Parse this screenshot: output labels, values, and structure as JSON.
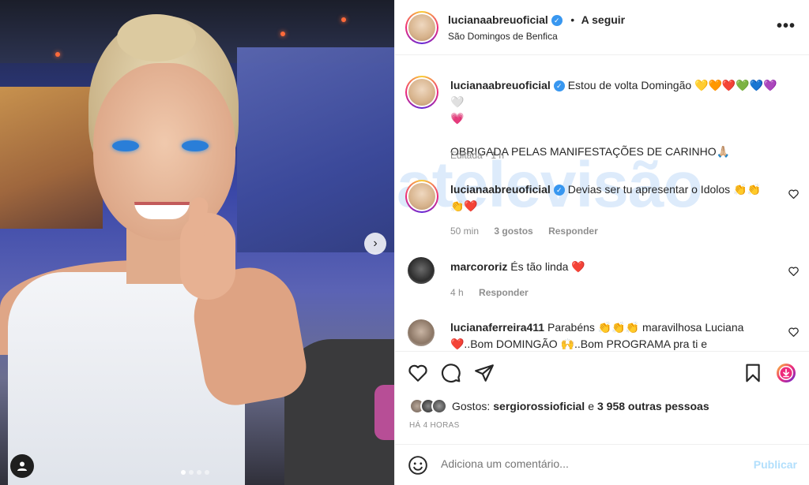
{
  "post": {
    "author": "lucianaabreuoficial",
    "follow_label": "A seguir",
    "location": "São Domingos de Benfica",
    "more_label": "•••"
  },
  "caption": {
    "author": "lucianaabreuoficial",
    "line1": "Estou de volta Domingão 💛🧡❤️💚💙💜🤍",
    "line2": "💗",
    "line3": "OBRIGADA PELAS MANIFESTAÇÕES DE CARINHO🙏🏼",
    "edited": "Editada · 1 h"
  },
  "comments": [
    {
      "author": "lucianaabreuoficial",
      "text_line1": "Devias ser tu apresentar o Idolos 👏👏",
      "text_line2": "👏❤️",
      "time": "50 min",
      "likes": "3 gostos",
      "reply": "Responder"
    },
    {
      "author": "marcororiz",
      "text_line1": "És tão linda ❤️",
      "time": "4 h",
      "reply": "Responder"
    },
    {
      "author": "lucianaferreira411",
      "text_line1": "Parabéns 👏👏👏 maravilhosa Luciana",
      "text_line2": "❤️..Bom DOMINGÃO 🙌..Bom PROGRAMA pra ti e"
    }
  ],
  "watermark": "atelevisão",
  "likes": {
    "prefix": "Gostos:",
    "user": "sergiorossioficial",
    "conj": "e",
    "others": "3 958 outras pessoas"
  },
  "timestamp": "HÁ 4 HORAS",
  "add_comment": {
    "placeholder": "Adiciona um comentário...",
    "post_label": "Publicar"
  },
  "carousel": {
    "next_icon": "chevron-right-icon",
    "slide_count": 4,
    "active_slide": 1
  },
  "colors": {
    "accent": "#0095f6",
    "post_disabled": "#b2dffc",
    "verified": "#3897f0",
    "watermark": "#cfe3fa"
  }
}
